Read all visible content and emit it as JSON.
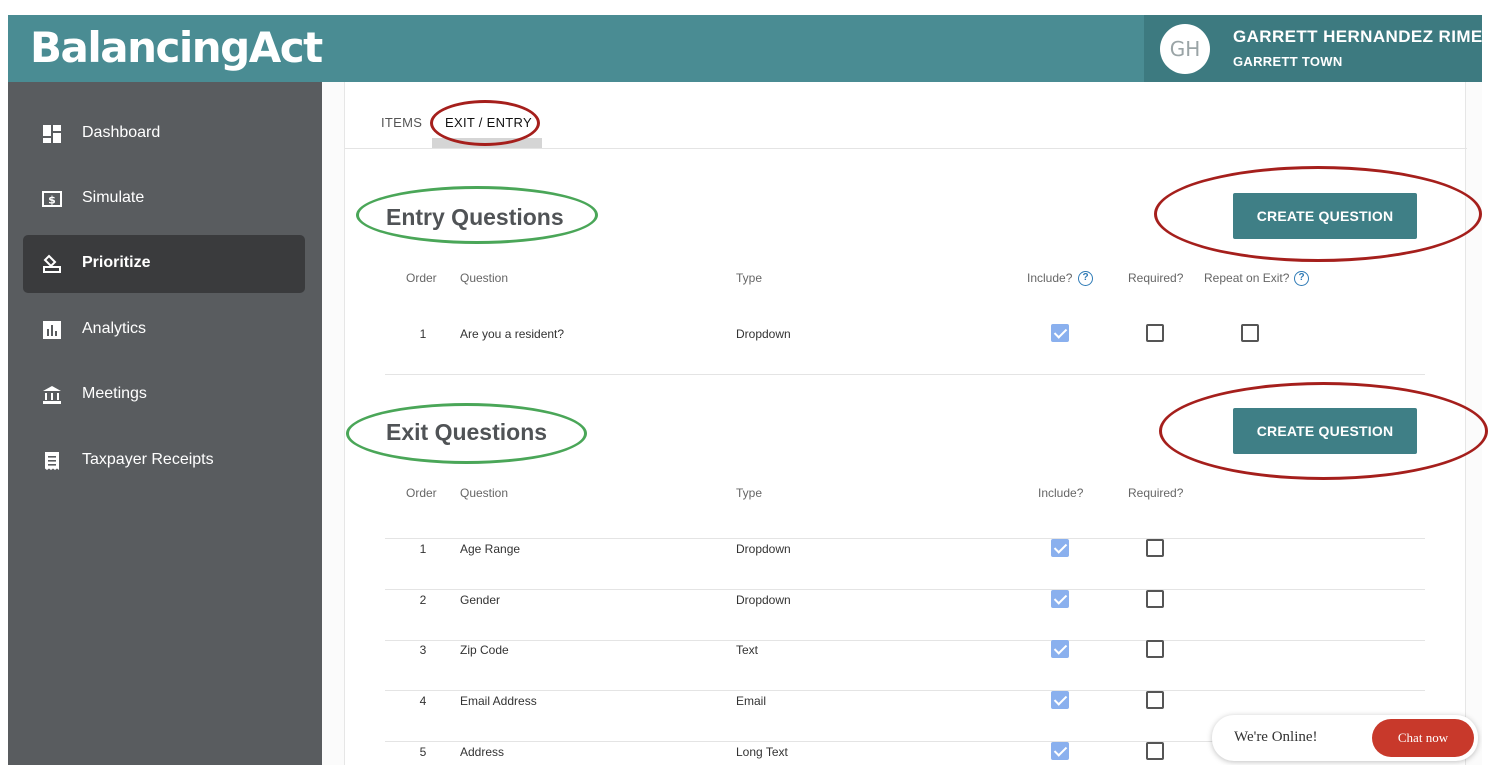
{
  "app": {
    "logo": "BalancingAct"
  },
  "user": {
    "initials": "GH",
    "name": "GARRETT HERNANDEZ RIMER",
    "town": "GARRETT TOWN"
  },
  "sidebar": {
    "items": [
      {
        "label": "Dashboard",
        "icon": "dashboard-icon"
      },
      {
        "label": "Simulate",
        "icon": "dollar-icon"
      },
      {
        "label": "Prioritize",
        "icon": "ballot-icon",
        "active": true
      },
      {
        "label": "Analytics",
        "icon": "bar-chart-icon"
      },
      {
        "label": "Meetings",
        "icon": "bank-icon"
      },
      {
        "label": "Taxpayer Receipts",
        "icon": "receipt-icon"
      }
    ]
  },
  "tabs": [
    {
      "label": "ITEMS"
    },
    {
      "label": "EXIT / ENTRY",
      "active": true
    }
  ],
  "entry": {
    "title": "Entry Questions",
    "create_label": "CREATE QUESTION",
    "headers": {
      "order": "Order",
      "question": "Question",
      "type": "Type",
      "include": "Include?",
      "required": "Required?",
      "repeat": "Repeat on Exit?"
    },
    "rows": [
      {
        "order": "1",
        "question": "Are you a resident?",
        "type": "Dropdown",
        "include": true,
        "required": false,
        "repeat": false
      }
    ]
  },
  "exit": {
    "title": "Exit Questions",
    "create_label": "CREATE QUESTION",
    "headers": {
      "order": "Order",
      "question": "Question",
      "type": "Type",
      "include": "Include?",
      "required": "Required?"
    },
    "rows": [
      {
        "order": "1",
        "question": "Age Range",
        "type": "Dropdown",
        "include": true,
        "required": false
      },
      {
        "order": "2",
        "question": "Gender",
        "type": "Dropdown",
        "include": true,
        "required": false
      },
      {
        "order": "3",
        "question": "Zip Code",
        "type": "Text",
        "include": true,
        "required": false
      },
      {
        "order": "4",
        "question": "Email Address",
        "type": "Email",
        "include": true,
        "required": false
      },
      {
        "order": "5",
        "question": "Address",
        "type": "Long Text",
        "include": true,
        "required": false
      }
    ]
  },
  "chat": {
    "status": "We're Online!",
    "button": "Chat now"
  },
  "colors": {
    "header": "#4a8c93",
    "sidebar": "#595c5f",
    "button": "#3f7f86",
    "annotation_red": "#a51f1c",
    "annotation_green": "#4aa658",
    "chat_button": "#c8392b"
  }
}
